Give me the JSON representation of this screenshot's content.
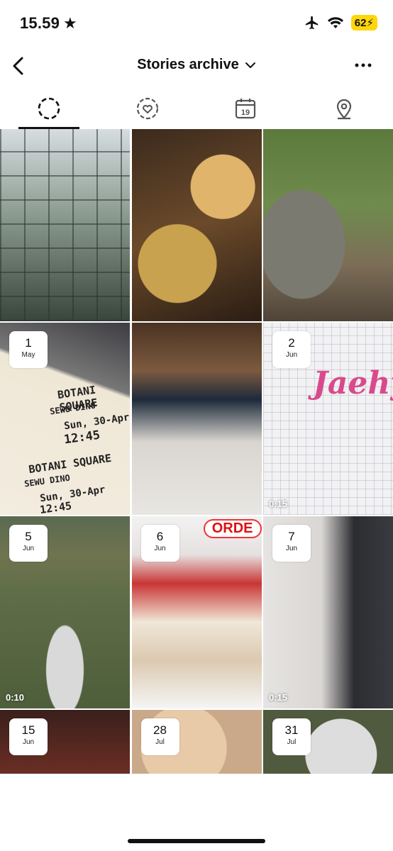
{
  "status_bar": {
    "time": "15.59",
    "battery": "62"
  },
  "header": {
    "title": "Stories archive"
  },
  "tabs": [
    {
      "name": "stories"
    },
    {
      "name": "memories"
    },
    {
      "name": "calendar",
      "label": "19"
    },
    {
      "name": "map"
    }
  ],
  "grid": {
    "tiles": [
      {
        "day": "",
        "month": "",
        "duration": ""
      },
      {
        "day": "",
        "month": "",
        "duration": ""
      },
      {
        "day": "",
        "month": "",
        "duration": ""
      },
      {
        "day": "1",
        "month": "May",
        "duration": ""
      },
      {
        "day": "",
        "month": "",
        "duration": ""
      },
      {
        "day": "2",
        "month": "Jun",
        "duration": "0:15"
      },
      {
        "day": "5",
        "month": "Jun",
        "duration": "0:10"
      },
      {
        "day": "6",
        "month": "Jun",
        "duration": ""
      },
      {
        "day": "7",
        "month": "Jun",
        "duration": "0:15"
      },
      {
        "day": "15",
        "month": "Jun",
        "duration": ""
      },
      {
        "day": "28",
        "month": "Jul",
        "duration": ""
      },
      {
        "day": "31",
        "month": "Jul",
        "duration": ""
      }
    ]
  },
  "photo_text": {
    "ticket_venue": "BOTANI SQUARE",
    "ticket_venue_2": "BOTANI SQUARE",
    "ticket_name": "SEWU DINO",
    "ticket_name_2": "SEWU DINO",
    "ticket_date": "Sun, 30-Apr",
    "ticket_date_2": "Sun, 30-Apr",
    "ticket_time": "12:45",
    "ticket_time_2": "12:45",
    "sketch_word": "Jaehyu",
    "order_sign": "ORDE"
  }
}
